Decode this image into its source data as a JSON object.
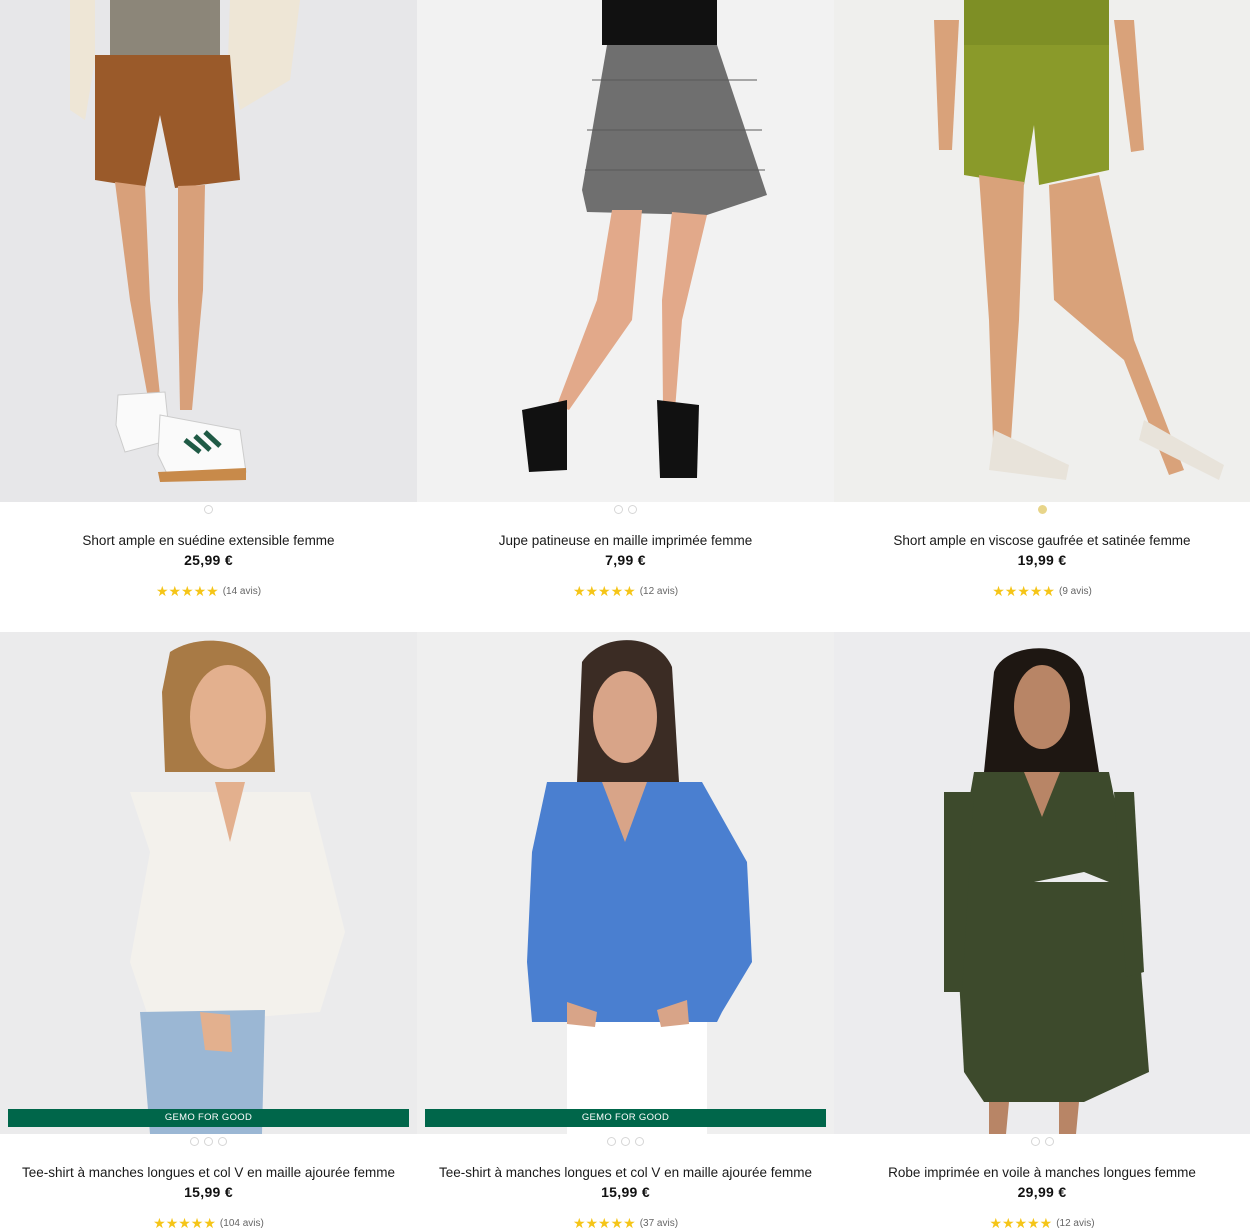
{
  "products": [
    {
      "name": "Short ample en suédine extensible femme",
      "price": "25,99 €",
      "stars": "★★★★★",
      "reviews": "(14 avis)",
      "badge": "",
      "dots": 1,
      "active_dot_color": ""
    },
    {
      "name": "Jupe patineuse en maille imprimée femme",
      "price": "7,99 €",
      "stars": "★★★★★",
      "reviews": "(12 avis)",
      "badge": "",
      "dots": 2,
      "active_dot_color": ""
    },
    {
      "name": "Short ample en viscose gaufrée et satinée femme",
      "price": "19,99 €",
      "stars": "★★★★★",
      "reviews": "(9 avis)",
      "badge": "",
      "dots": 1,
      "active_dot_color": "#e8d58a"
    },
    {
      "name": "Tee-shirt à manches longues et col V en maille ajourée femme",
      "price": "15,99 €",
      "stars": "★★★★★",
      "reviews": "(104 avis)",
      "badge": "GEMO FOR GOOD",
      "dots": 3,
      "active_dot_color": ""
    },
    {
      "name": "Tee-shirt à manches longues et col V en maille ajourée femme",
      "price": "15,99 €",
      "stars": "★★★★★",
      "reviews": "(37 avis)",
      "badge": "GEMO FOR GOOD",
      "dots": 3,
      "active_dot_color": ""
    },
    {
      "name": "Robe imprimée en voile à manches longues femme",
      "price": "29,99 €",
      "stars": "★★★★★",
      "reviews": "(12 avis)",
      "badge": "",
      "dots": 2,
      "active_dot_color": ""
    }
  ],
  "colors": {
    "badge_green": "#00664a",
    "star_yellow": "#f5c518",
    "short_brown": "#9a5a2a",
    "skirt_grey": "#6f6f6f",
    "short_olive": "#8a9a2a",
    "top_white": "#f3f1ec",
    "top_blue": "#4a7fd0",
    "dress_green": "#3d4a2c"
  }
}
